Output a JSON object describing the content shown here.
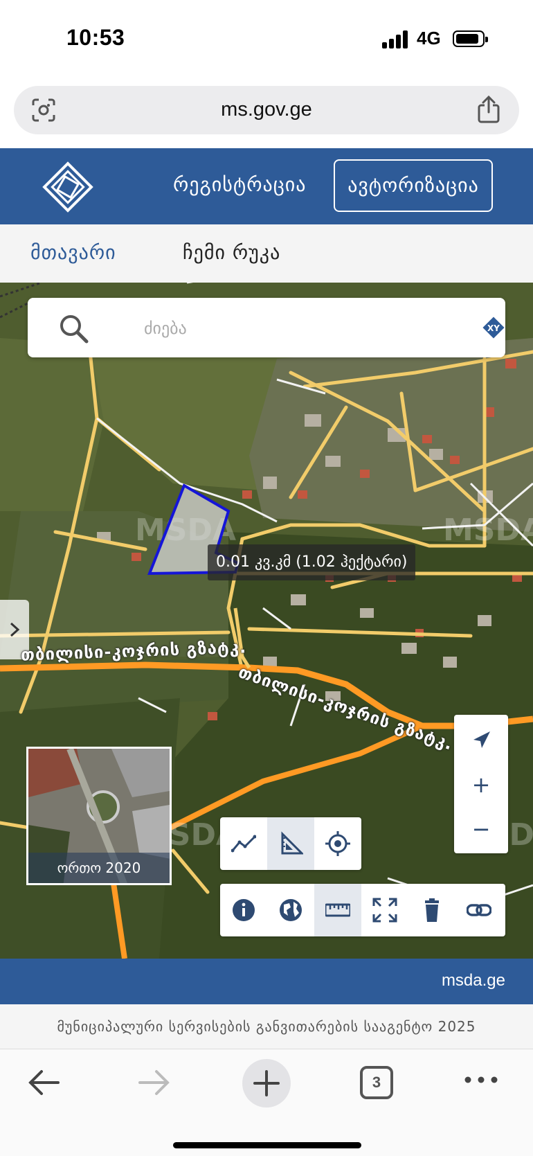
{
  "status_bar": {
    "time": "10:53",
    "network": "4G"
  },
  "browser": {
    "url": "ms.gov.ge",
    "open_tabs": "3"
  },
  "header": {
    "register_label": "რეგისტრაცია",
    "auth_label": "ავტორიზაცია"
  },
  "tabs": [
    {
      "label": "მთავარი",
      "active": true
    },
    {
      "label": "ჩემი რუკა",
      "active": false
    }
  ],
  "search": {
    "placeholder": "ძიება",
    "xy_label": "XY"
  },
  "map": {
    "measurement": "0.01 კვ.კმ (1.02 ჰექტარი)",
    "watermark": "MSDA",
    "road_label_1": "თბილისი-კოჯრის გზატკ.",
    "road_label_2": "თბილისი-კოჯრის გზატკ.",
    "minimap_caption": "ორთო 2020",
    "colors": {
      "polygon_stroke": "#1515d8",
      "road_main": "#ff9a24",
      "road_minor": "#f2cc6a",
      "accent": "#2e5b98"
    }
  },
  "tools": {
    "row1": [
      "line-measure-icon",
      "area-measure-icon",
      "locate-icon"
    ],
    "row2": [
      "info-icon",
      "globe-icon",
      "ruler-icon",
      "fullscreen-icon",
      "trash-icon",
      "link-icon"
    ],
    "active": [
      "area-measure-icon",
      "ruler-icon"
    ]
  },
  "footer": {
    "domain": "msda.ge",
    "copyright": "მუნიციპალური სერვისების განვითარების სააგენტო 2025"
  }
}
